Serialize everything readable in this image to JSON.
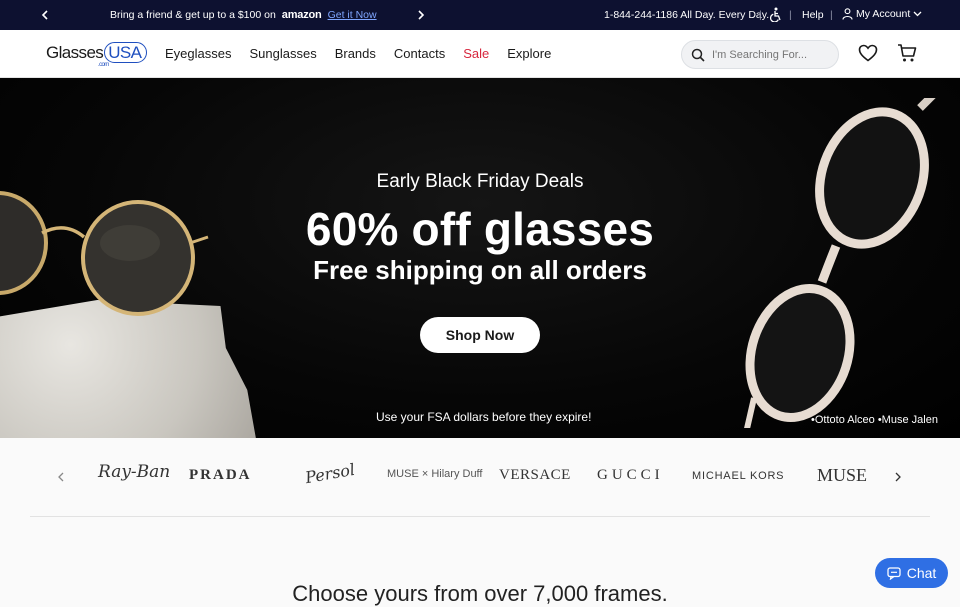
{
  "topbar": {
    "promo_text": "Bring a friend & get up to a $100 on",
    "promo_brand": "amazon",
    "promo_link": "Get it Now",
    "phone": "1-844-244-1186 All Day. Every Day.",
    "help": "Help",
    "account": "My Account"
  },
  "nav": {
    "logo_main": "Glasses",
    "logo_accent": "USA",
    "logo_suffix": ".com",
    "menu": [
      "Eyeglasses",
      "Sunglasses",
      "Brands",
      "Contacts",
      "Sale",
      "Explore"
    ],
    "search_placeholder": "I'm Searching For..."
  },
  "hero": {
    "subtitle": "Early Black Friday Deals",
    "title": "60% off glasses",
    "line": "Free shipping on all orders",
    "button": "Shop Now",
    "fsa": "Use your FSA dollars before they expire!",
    "credit": "•Ottoto Alceo •Muse Jalen"
  },
  "brands": {
    "items": [
      "Ray-Ban",
      "PRADA",
      "Persol",
      "MUSE",
      "Hilary Duff",
      "VERSACE",
      "GUCCI",
      "MICHAEL KORS",
      "MUSE"
    ]
  },
  "section": {
    "choose": "Choose yours from over 7,000 frames."
  },
  "chat": {
    "label": "Chat"
  },
  "colors": {
    "topbar_bg": "#0d1130",
    "sale": "#d7263d",
    "link": "#7fa6ff",
    "chat_bg": "#2f6fe4"
  }
}
